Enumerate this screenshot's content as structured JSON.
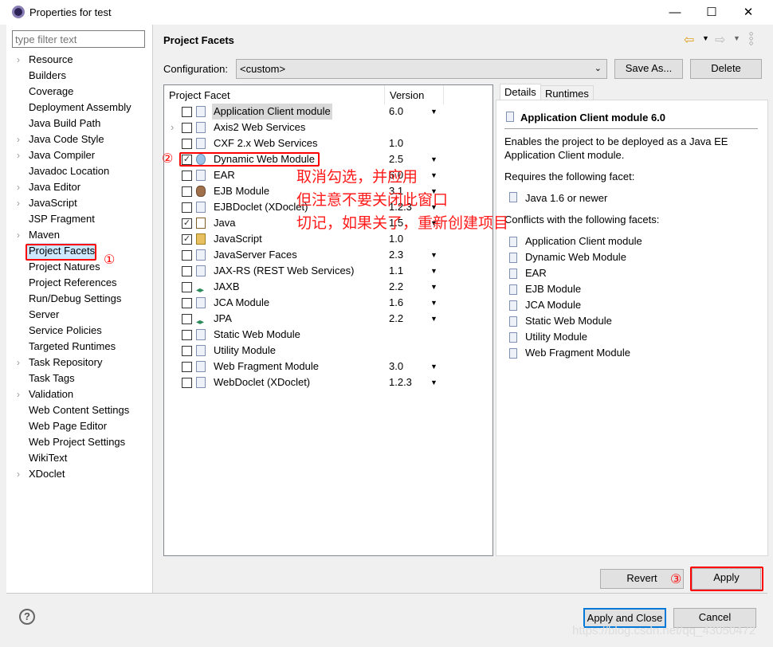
{
  "window": {
    "title": "Properties for test",
    "minimize": "—",
    "maximize": "☐",
    "close": "✕"
  },
  "sidebar": {
    "filter_placeholder": "type filter text",
    "items": [
      {
        "label": "Resource",
        "expandable": true
      },
      {
        "label": "Builders"
      },
      {
        "label": "Coverage"
      },
      {
        "label": "Deployment Assembly"
      },
      {
        "label": "Java Build Path"
      },
      {
        "label": "Java Code Style",
        "expandable": true
      },
      {
        "label": "Java Compiler",
        "expandable": true
      },
      {
        "label": "Javadoc Location"
      },
      {
        "label": "Java Editor",
        "expandable": true
      },
      {
        "label": "JavaScript",
        "expandable": true
      },
      {
        "label": "JSP Fragment"
      },
      {
        "label": "Maven",
        "expandable": true
      },
      {
        "label": "Project Facets",
        "selected": true
      },
      {
        "label": "Project Natures"
      },
      {
        "label": "Project References"
      },
      {
        "label": "Run/Debug Settings"
      },
      {
        "label": "Server"
      },
      {
        "label": "Service Policies"
      },
      {
        "label": "Targeted Runtimes"
      },
      {
        "label": "Task Repository",
        "expandable": true
      },
      {
        "label": "Task Tags"
      },
      {
        "label": "Validation",
        "expandable": true
      },
      {
        "label": "Web Content Settings"
      },
      {
        "label": "Web Page Editor"
      },
      {
        "label": "Web Project Settings"
      },
      {
        "label": "WikiText"
      },
      {
        "label": "XDoclet",
        "expandable": true
      }
    ]
  },
  "page": {
    "title": "Project Facets",
    "config_label": "Configuration:",
    "config_value": "<custom>",
    "save_as": "Save As...",
    "delete": "Delete"
  },
  "facets": {
    "col_facet": "Project Facet",
    "col_version": "Version",
    "rows": [
      {
        "name": "Application Client module",
        "version": "6.0",
        "dropdown": true,
        "checked": false,
        "highlighted": true
      },
      {
        "name": "Axis2 Web Services",
        "version": "",
        "checked": false,
        "expandable": true
      },
      {
        "name": "CXF 2.x Web Services",
        "version": "1.0",
        "checked": false
      },
      {
        "name": "Dynamic Web Module",
        "version": "2.5",
        "dropdown": true,
        "checked": true,
        "icon": "globe"
      },
      {
        "name": "EAR",
        "version": "6.0",
        "dropdown": true,
        "checked": false
      },
      {
        "name": "EJB Module",
        "version": "3.1",
        "dropdown": true,
        "checked": false,
        "icon": "bean"
      },
      {
        "name": "EJBDoclet (XDoclet)",
        "version": "1.2.3",
        "dropdown": true,
        "checked": false
      },
      {
        "name": "Java",
        "version": "1.5",
        "dropdown": true,
        "checked": true,
        "icon": "java"
      },
      {
        "name": "JavaScript",
        "version": "1.0",
        "checked": true,
        "icon": "lock"
      },
      {
        "name": "JavaServer Faces",
        "version": "2.3",
        "dropdown": true,
        "checked": false
      },
      {
        "name": "JAX-RS (REST Web Services)",
        "version": "1.1",
        "dropdown": true,
        "checked": false
      },
      {
        "name": "JAXB",
        "version": "2.2",
        "dropdown": true,
        "checked": false,
        "icon": "arrows"
      },
      {
        "name": "JCA Module",
        "version": "1.6",
        "dropdown": true,
        "checked": false
      },
      {
        "name": "JPA",
        "version": "2.2",
        "dropdown": true,
        "checked": false,
        "icon": "arrows"
      },
      {
        "name": "Static Web Module",
        "version": "",
        "checked": false
      },
      {
        "name": "Utility Module",
        "version": "",
        "checked": false
      },
      {
        "name": "Web Fragment Module",
        "version": "3.0",
        "dropdown": true,
        "checked": false
      },
      {
        "name": "WebDoclet (XDoclet)",
        "version": "1.2.3",
        "dropdown": true,
        "checked": false
      }
    ]
  },
  "details": {
    "tabs": [
      "Details",
      "Runtimes"
    ],
    "heading": "Application Client module 6.0",
    "desc1": "Enables the project to be deployed as a Java EE",
    "desc2": "Application Client module.",
    "requires_label": "Requires the following facet:",
    "requires": [
      "Java 1.6 or newer"
    ],
    "conflicts_label": "Conflicts with the following facets:",
    "conflicts": [
      "Application Client module",
      "Dynamic Web Module",
      "EAR",
      "EJB Module",
      "JCA Module",
      "Static Web Module",
      "Utility Module",
      "Web Fragment Module"
    ]
  },
  "buttons": {
    "revert": "Revert",
    "apply": "Apply",
    "apply_close": "Apply and Close",
    "cancel": "Cancel",
    "help": "?"
  },
  "annotations": {
    "c1": "①",
    "c2": "②",
    "c3": "③",
    "note": [
      "取消勾选，并应用",
      "但注意不要关闭此窗口",
      "切记，如果关了，重新创建项目"
    ]
  },
  "watermark": "https://blog.csdn.net/qq_43050472",
  "colors": {
    "annotation": "#ff0000",
    "selection": "#cce8ff",
    "default_button_border": "#0078d7"
  }
}
